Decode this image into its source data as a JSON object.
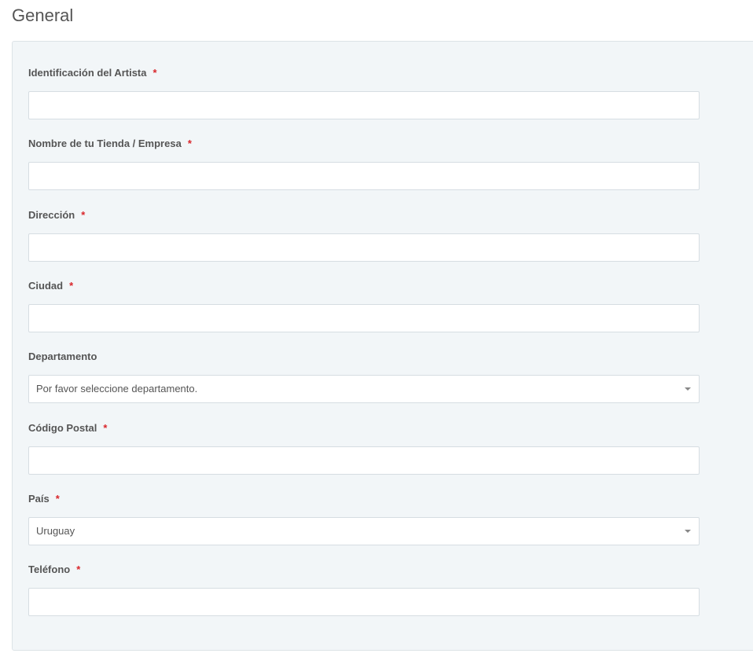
{
  "section": {
    "title": "General"
  },
  "required_marker": "*",
  "fields": {
    "artist_id": {
      "label": "Identificación del Artista",
      "value": ""
    },
    "store_name": {
      "label": "Nombre de tu Tienda / Empresa",
      "value": ""
    },
    "address": {
      "label": "Dirección",
      "value": ""
    },
    "city": {
      "label": "Ciudad",
      "value": ""
    },
    "department": {
      "label": "Departamento",
      "selected": "Por favor seleccione departamento."
    },
    "postal_code": {
      "label": "Código Postal",
      "value": ""
    },
    "country": {
      "label": "País",
      "selected": "Uruguay"
    },
    "phone": {
      "label": "Teléfono",
      "value": ""
    }
  }
}
